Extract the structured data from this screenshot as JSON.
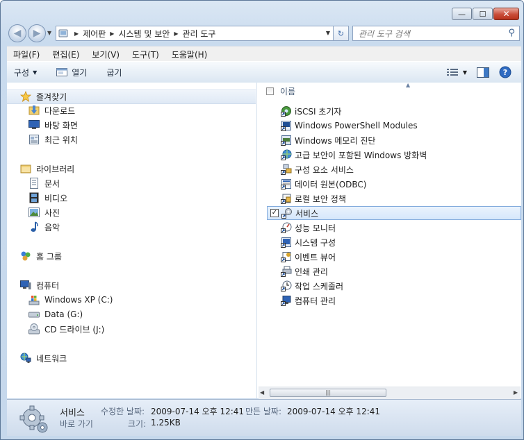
{
  "window": {
    "minimize_label": "—",
    "maximize_label": "☐",
    "close_label": "✕"
  },
  "nav": {
    "back_label": "◀",
    "forward_label": "▶"
  },
  "address": {
    "crumbs": [
      "제어판",
      "시스템 및 보안",
      "관리 도구"
    ],
    "separator": "▶"
  },
  "search": {
    "placeholder": "관리 도구 검색"
  },
  "menu": {
    "items": [
      "파일(F)",
      "편집(E)",
      "보기(V)",
      "도구(T)",
      "도움말(H)"
    ]
  },
  "toolbar": {
    "organize_label": "구성",
    "open_label": "열기",
    "burn_label": "굽기"
  },
  "sidebar": {
    "favorites": {
      "label": "즐겨찾기",
      "items": [
        "다운로드",
        "바탕 화면",
        "최근 위치"
      ]
    },
    "libraries": {
      "label": "라이브러리",
      "items": [
        "문서",
        "비디오",
        "사진",
        "음악"
      ]
    },
    "homegroup": {
      "label": "홈 그룹"
    },
    "computer": {
      "label": "컴퓨터",
      "items": [
        "Windows XP (C:)",
        "Data (G:)",
        "CD 드라이브 (J:)"
      ]
    },
    "network": {
      "label": "네트워크"
    }
  },
  "file_list": {
    "column_name": "이름",
    "selected_index": 7,
    "items": [
      "iSCSI 초기자",
      "Windows PowerShell Modules",
      "Windows 메모리 진단",
      "고급 보안이 포함된 Windows 방화벽",
      "구성 요소 서비스",
      "데이터 원본(ODBC)",
      "로컬 보안 정책",
      "서비스",
      "성능 모니터",
      "시스템 구성",
      "이벤트 뷰어",
      "인쇄 관리",
      "작업 스케줄러",
      "컴퓨터 관리"
    ]
  },
  "scrollbar": {
    "grip": "|||"
  },
  "details": {
    "name": "서비스",
    "type": "바로 가기",
    "modified_key": "수정한 날짜:",
    "modified_value": "2009-07-14 오후 12:41",
    "created_key": "만든 날짜:",
    "created_value": "2009-07-14 오후 12:41",
    "size_key": "크기:",
    "size_value": "1.25KB"
  }
}
